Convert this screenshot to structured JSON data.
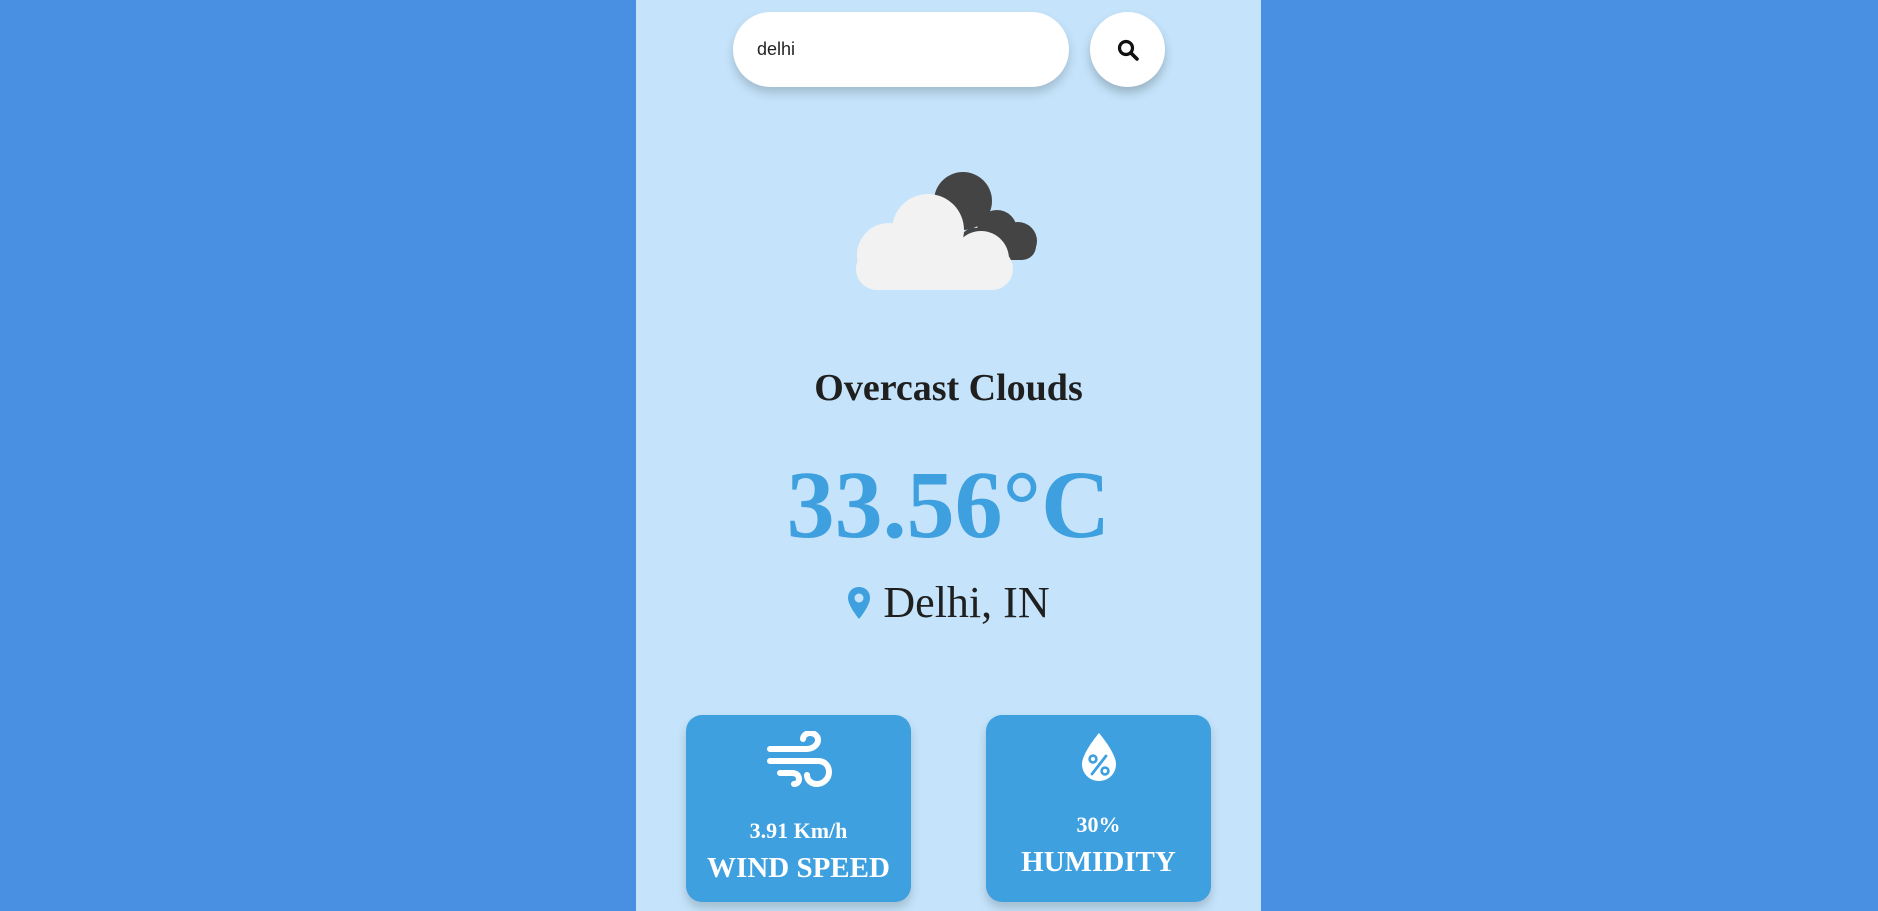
{
  "search": {
    "value": "delhi",
    "button_icon": "search-icon"
  },
  "weather": {
    "icon": "overcast-clouds-icon",
    "condition": "Overcast Clouds",
    "temperature": "33.56°C",
    "location": "Delhi, IN",
    "location_icon": "map-pin-icon"
  },
  "stats": {
    "wind": {
      "icon": "wind-icon",
      "value": "3.91 Km/h",
      "label": "WIND SPEED"
    },
    "humidity": {
      "icon": "humidity-icon",
      "value": "30%",
      "label": "HUMIDITY"
    }
  },
  "colors": {
    "page_background": "#4a90e2",
    "app_background": "#c5e4fb",
    "accent": "#3fa0e0",
    "text": "#1f1f1f"
  }
}
